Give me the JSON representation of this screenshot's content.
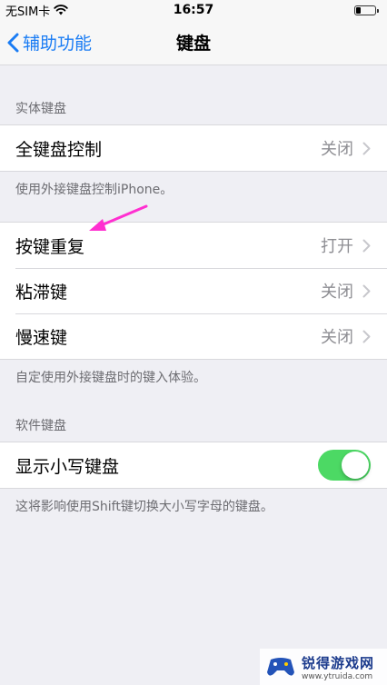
{
  "status_bar": {
    "carrier": "无SIM卡",
    "time": "16:57"
  },
  "nav": {
    "back_label": "辅助功能",
    "title": "键盘"
  },
  "physical_keyboard": {
    "header": "实体键盘",
    "full_keyboard_control": {
      "label": "全键盘控制",
      "value": "关闭"
    },
    "footer": "使用外接键盘控制iPhone。"
  },
  "key_settings": {
    "rows": [
      {
        "label": "按键重复",
        "value": "打开"
      },
      {
        "label": "粘滞键",
        "value": "关闭"
      },
      {
        "label": "慢速键",
        "value": "关闭"
      }
    ],
    "footer": "自定使用外接键盘时的键入体验。"
  },
  "software_keyboard": {
    "header": "软件键盘",
    "lowercase": {
      "label": "显示小写键盘",
      "on": true
    },
    "footer": "这将影响使用Shift键切换大小写字母的键盘。"
  },
  "watermark": {
    "name": "锐得游戏网",
    "url": "www.ytruida.com"
  },
  "colors": {
    "accent": "#1a7cf4",
    "toggle_on": "#4cd964",
    "annotation_arrow": "#ff2fd0",
    "background": "#efeff4"
  }
}
